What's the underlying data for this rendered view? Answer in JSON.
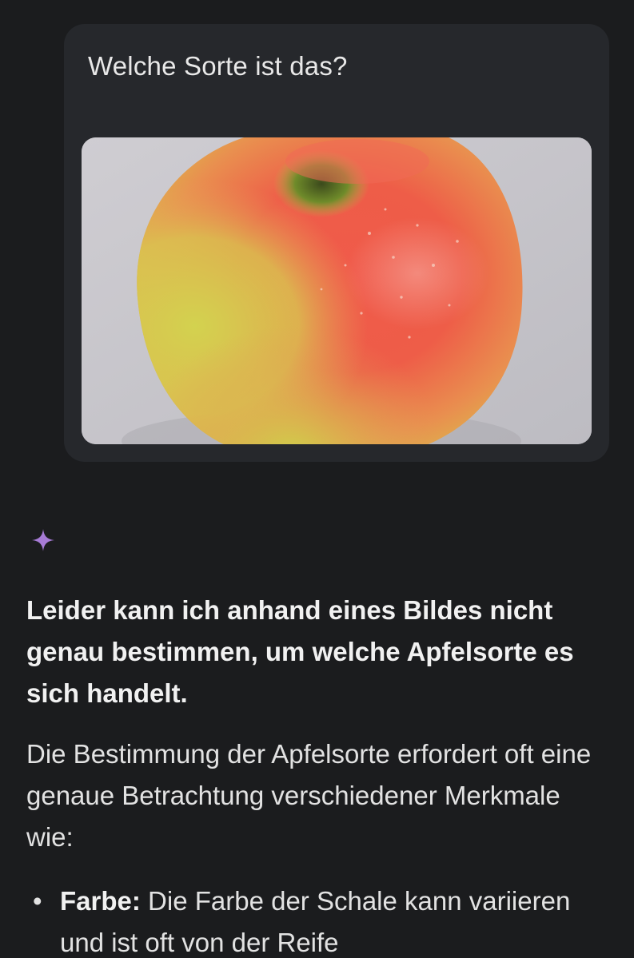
{
  "user_message": {
    "text": "Welche Sorte ist das?",
    "image_alt": "apple photo"
  },
  "assistant": {
    "icon": "gemini-sparkle-icon",
    "heading": "Leider kann ich anhand eines Bildes nicht genau bestimmen, um welche Apfelsorte es sich handelt.",
    "paragraph": "Die Bestimmung der Apfelsorte erfordert oft eine genaue Betrachtung verschiedener Merkmale wie:",
    "bullets": [
      {
        "term": "Farbe:",
        "text": " Die Farbe der Schale kann variieren und ist oft von der Reife"
      }
    ]
  },
  "colors": {
    "background": "#1b1c1e",
    "bubble": "#26282c",
    "accent": "#a77bd6"
  }
}
